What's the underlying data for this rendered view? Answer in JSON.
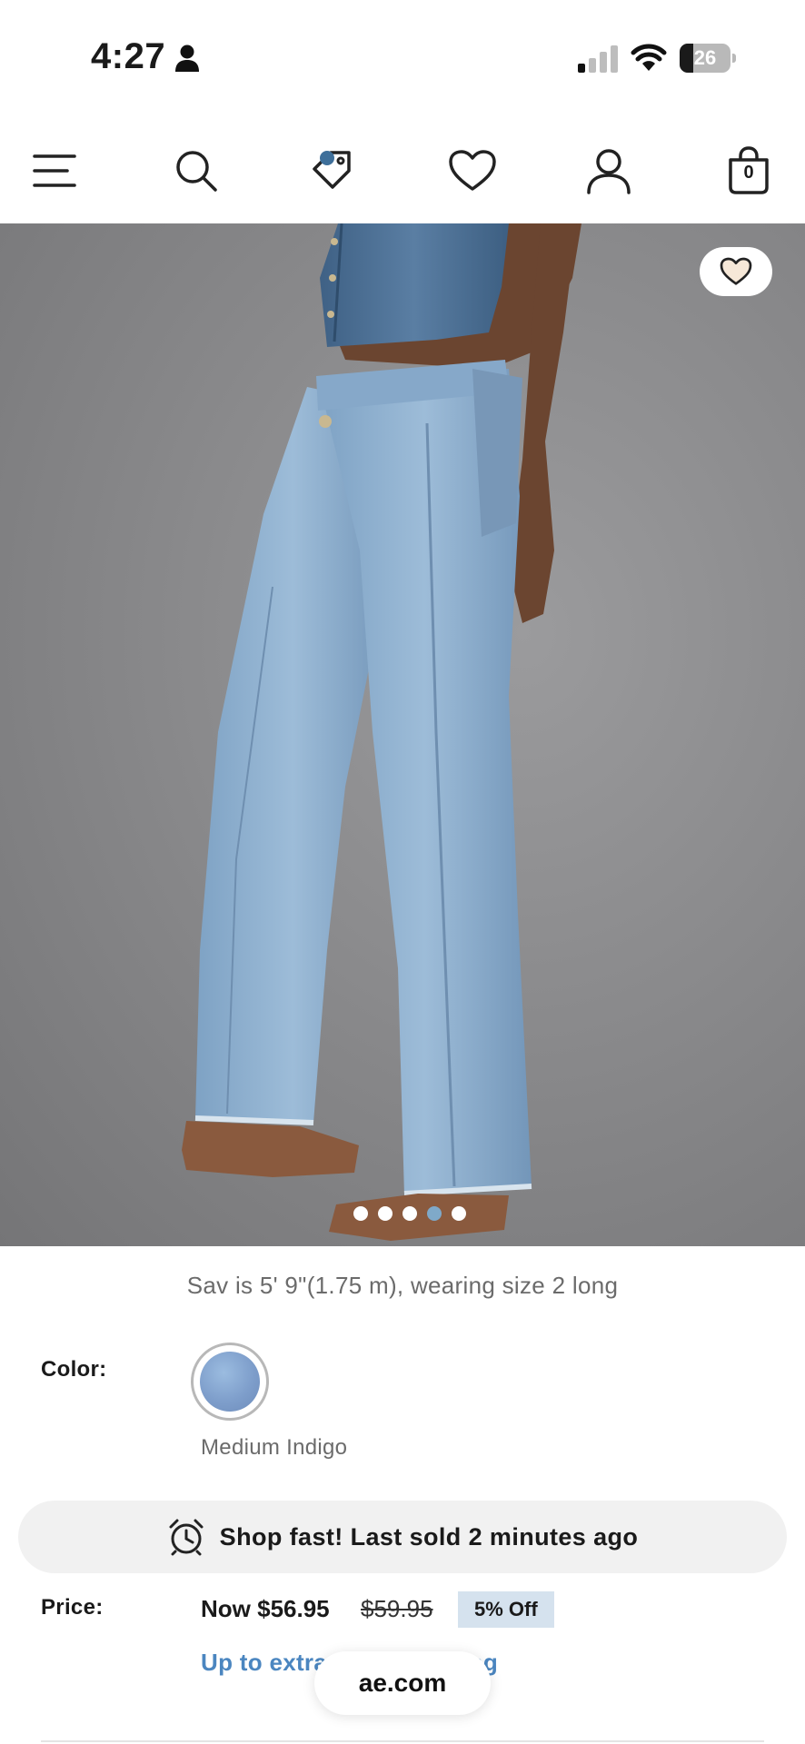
{
  "status_bar": {
    "time": "4:27",
    "battery_level": "26",
    "battery_fraction": 0.26
  },
  "nav": {
    "icons": [
      "menu-icon",
      "search-icon",
      "tag-icon",
      "heart-icon",
      "account-icon",
      "bag-icon"
    ],
    "bag_count": "0",
    "accent_color": "#3e6f9a"
  },
  "carousel": {
    "total": 5,
    "active_index": 4
  },
  "product": {
    "model_caption": "Sav is 5' 9\"(1.75 m), wearing size 2 long",
    "color_label": "Color:",
    "color_name": "Medium Indigo",
    "swatch_color": "#7e9ecb",
    "urgency_text": "Shop fast! Last sold 2 minutes ago",
    "price_label": "Price:",
    "price_now": "Now $56.95",
    "price_was": "$59.95",
    "discount": "5% Off",
    "promo_text": "Up to extra 30% off in bag"
  },
  "browser": {
    "url": "ae.com"
  }
}
